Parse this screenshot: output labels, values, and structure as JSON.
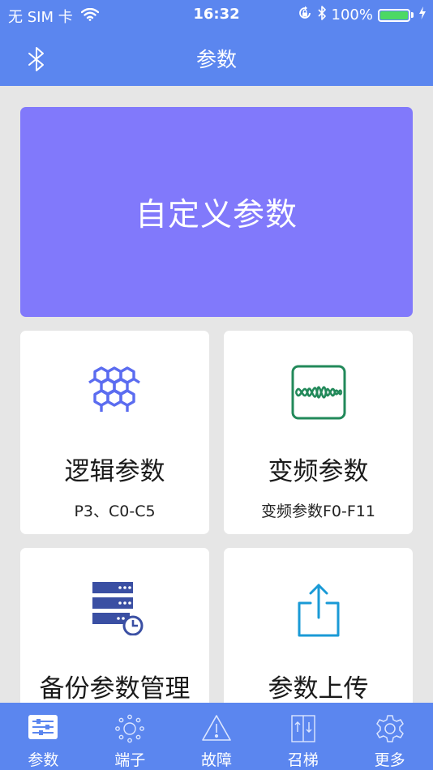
{
  "status_bar": {
    "carrier": "无 SIM 卡",
    "time": "16:32",
    "battery": "100%",
    "battery_level": 1.0
  },
  "nav": {
    "title": "参数"
  },
  "custom_card": {
    "label": "自定义参数"
  },
  "cards": [
    {
      "title": "逻辑参数",
      "subtitle": "P3、C0-C5",
      "icon": "hexagon-network-icon",
      "icon_color": "#5b6cf0"
    },
    {
      "title": "变频参数",
      "subtitle": "变频参数F0-F11",
      "icon": "waveform-icon",
      "icon_color": "#22895a"
    },
    {
      "title": "备份参数管理",
      "subtitle": "",
      "icon": "server-backup-icon",
      "icon_color": "#3a4fa3"
    },
    {
      "title": "参数上传",
      "subtitle": "",
      "icon": "upload-share-icon",
      "icon_color": "#1a9ad6"
    }
  ],
  "tabs": [
    {
      "label": "参数",
      "icon": "sliders-icon",
      "active": true
    },
    {
      "label": "端子",
      "icon": "terminal-nodes-icon",
      "active": false
    },
    {
      "label": "故障",
      "icon": "warning-icon",
      "active": false
    },
    {
      "label": "召梯",
      "icon": "elevator-icon",
      "active": false
    },
    {
      "label": "更多",
      "icon": "gear-icon",
      "active": false
    }
  ],
  "colors": {
    "primary": "#5b86ef",
    "custom_card": "#8179fb",
    "background": "#e6e6e6",
    "battery_fill": "#4cd964"
  }
}
